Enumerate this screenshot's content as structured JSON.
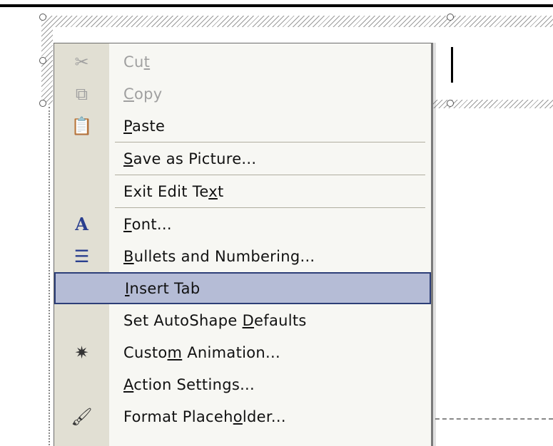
{
  "menu": {
    "items": [
      {
        "id": "cut",
        "pre": "Cu",
        "key": "t",
        "post": "",
        "icon": "scissors-icon",
        "glyph": "✂",
        "disabled": true
      },
      {
        "id": "copy",
        "pre": "",
        "key": "C",
        "post": "opy",
        "icon": "copy-icon",
        "glyph": "⧉",
        "disabled": true
      },
      {
        "id": "paste",
        "pre": "",
        "key": "P",
        "post": "aste",
        "icon": "clipboard-paste-icon",
        "glyph": "📋",
        "disabled": false
      },
      {
        "id": "save-as-picture",
        "pre": "",
        "key": "S",
        "post": "ave as Picture...",
        "icon": "",
        "glyph": "",
        "disabled": false
      },
      {
        "id": "exit-edit-text",
        "pre": "Exit Edit Te",
        "key": "x",
        "post": "t",
        "icon": "",
        "glyph": "",
        "disabled": false
      },
      {
        "id": "font",
        "pre": "",
        "key": "F",
        "post": "ont...",
        "icon": "font-icon",
        "glyph": "A",
        "disabled": false
      },
      {
        "id": "bullets-and-numbering",
        "pre": "",
        "key": "B",
        "post": "ullets and Numbering...",
        "icon": "bulleted-list-icon",
        "glyph": "☰",
        "disabled": false
      },
      {
        "id": "insert-tab",
        "pre": "",
        "key": "I",
        "post": "nsert Tab",
        "icon": "",
        "glyph": "",
        "disabled": false,
        "highlighted": true
      },
      {
        "id": "set-autoshape-defaults",
        "pre": "Set AutoShape ",
        "key": "D",
        "post": "efaults",
        "icon": "",
        "glyph": "",
        "disabled": false
      },
      {
        "id": "custom-animation",
        "pre": "Custo",
        "key": "m",
        "post": " Animation...",
        "icon": "animation-star-icon",
        "glyph": "✷",
        "disabled": false
      },
      {
        "id": "action-settings",
        "pre": "",
        "key": "A",
        "post": "ction Settings...",
        "icon": "",
        "glyph": "",
        "disabled": false
      },
      {
        "id": "format-placeholder",
        "pre": "Format Placeh",
        "key": "o",
        "post": "lder...",
        "icon": "format-brush-icon",
        "glyph": "🖌",
        "disabled": false
      }
    ],
    "separators_after": [
      "paste",
      "save-as-picture",
      "exit-edit-text"
    ]
  }
}
